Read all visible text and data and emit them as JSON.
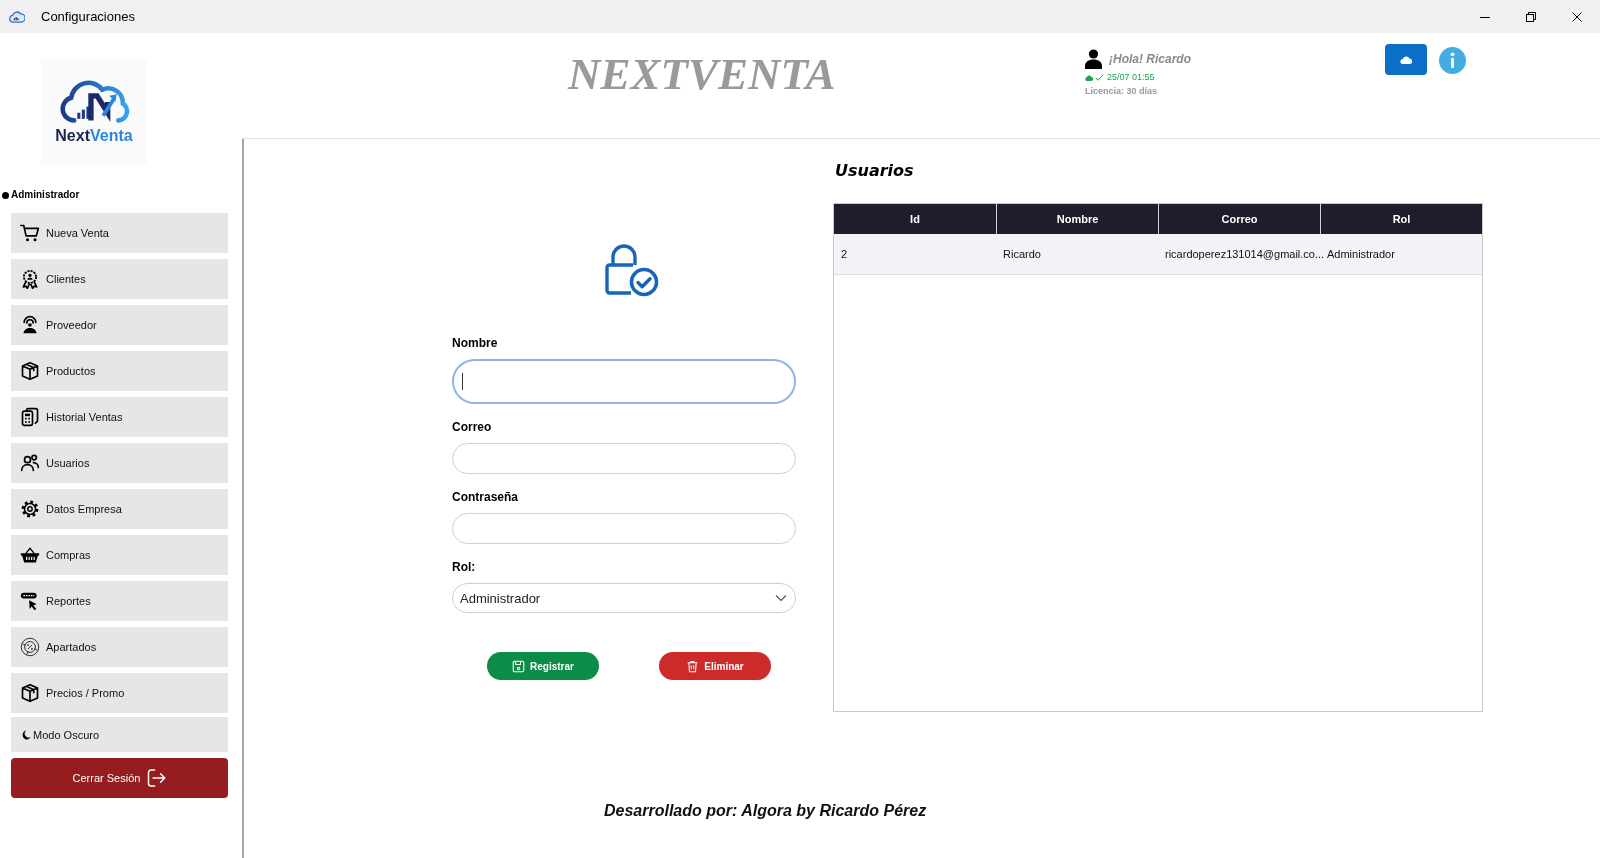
{
  "window": {
    "title": "Configuraciones"
  },
  "sidebar": {
    "logo": {
      "wordmark": [
        "Next",
        "Venta"
      ]
    },
    "role": "Administrador",
    "items": [
      "Nueva Venta",
      "Clientes",
      "Proveedor",
      "Productos",
      "Historial Ventas",
      "Usuarios",
      "Datos Empresa",
      "Compras",
      "Reportes",
      "Apartados",
      "Precios / Promo"
    ],
    "dark_mode": {
      "label": "Modo Oscuro"
    },
    "logout": {
      "label": "Cerrar Sesión"
    }
  },
  "header": {
    "app_title": "NEXTVENTA",
    "greeting": "¡Hola! Ricardo",
    "sync_time": "25/07 01:55",
    "license": "Licencia: 30 días"
  },
  "form": {
    "fields": [
      {
        "label": "Nombre",
        "kind": "text",
        "focused": true
      },
      {
        "label": "Correo",
        "kind": "text",
        "focused": false
      },
      {
        "label": "Contraseña",
        "kind": "text",
        "focused": false
      },
      {
        "label": "Rol:",
        "kind": "select",
        "focused": false,
        "value": "Administrador"
      }
    ],
    "buttons": [
      {
        "label": "Registrar",
        "kind": "save"
      },
      {
        "label": "Eliminar",
        "kind": "delete"
      }
    ]
  },
  "users": {
    "title": "Usuarios",
    "table": {
      "columns": [
        "Id",
        "Nombre",
        "Correo",
        "Rol"
      ],
      "rows": [
        [
          "2",
          "Ricardo",
          "ricardoperez131014@gmail.co...",
          "Administrador"
        ]
      ]
    }
  },
  "footer": "Desarrollado por: Algora by Ricardo Pérez"
}
